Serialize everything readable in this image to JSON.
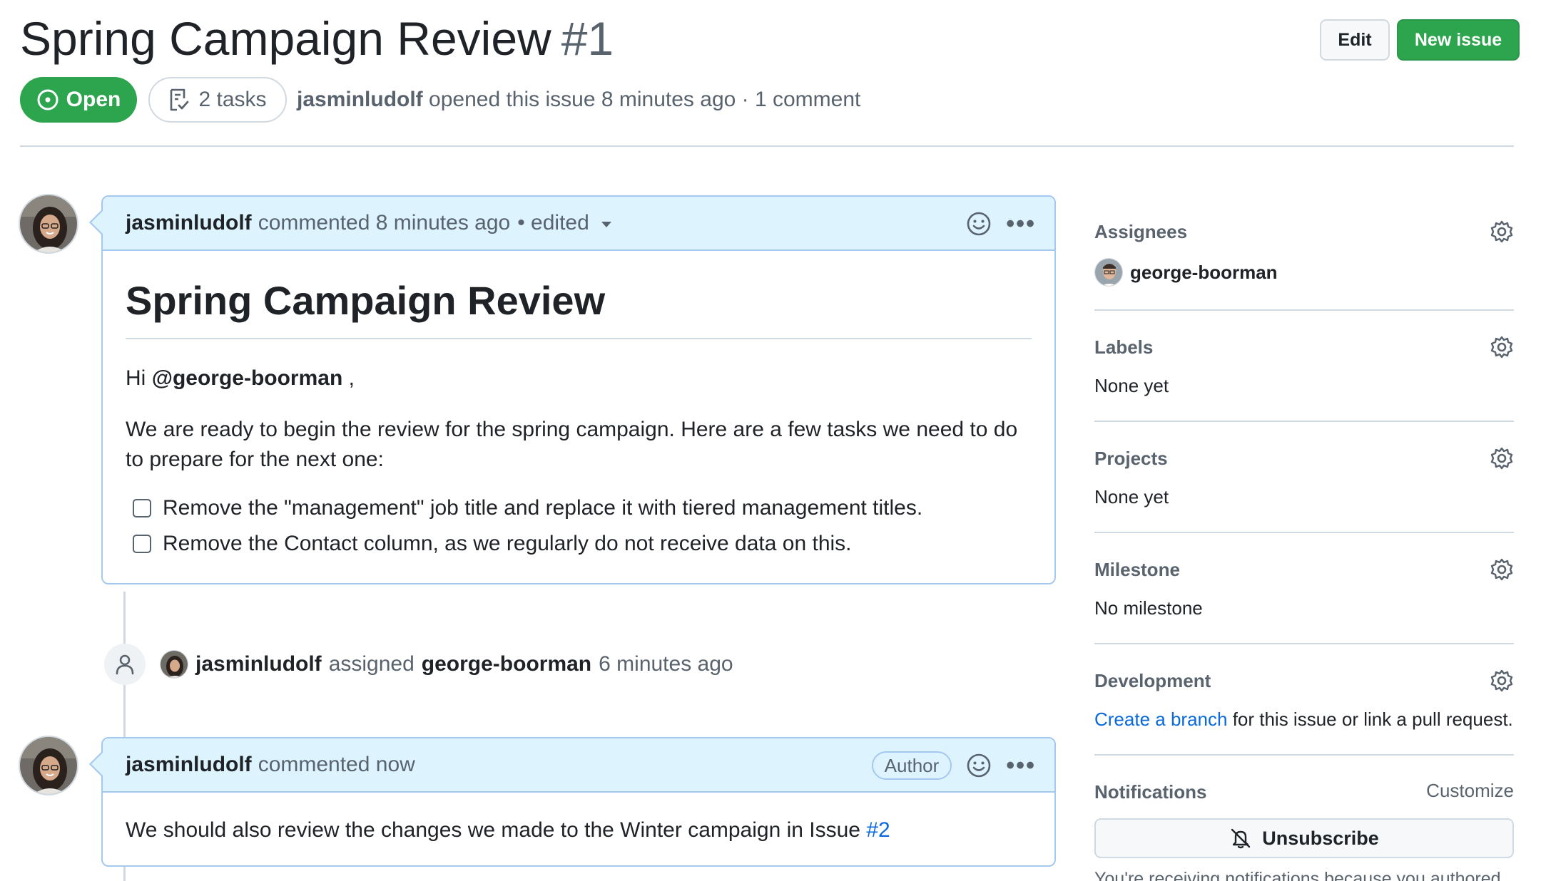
{
  "issue": {
    "title": "Spring Campaign Review",
    "number": "#1",
    "state": "Open",
    "tasks": "2 tasks",
    "author": "jasminludolf",
    "meta_text": "opened this issue 8 minutes ago · 1 comment"
  },
  "header_buttons": {
    "edit": "Edit",
    "new_issue": "New issue"
  },
  "comments": [
    {
      "author": "jasminludolf",
      "action": "commented 8 minutes ago",
      "edited": "• edited",
      "heading": "Spring Campaign Review",
      "greeting_prefix": "Hi",
      "mention": "@george-boorman",
      "greeting_suffix": ",",
      "paragraph": "We are ready to begin the review for the spring campaign. Here are a few tasks we need to do to prepare for the next one:",
      "tasks": [
        "Remove the \"management\" job title and replace it with tiered management titles.",
        "Remove the Contact column, as we regularly do not receive data on this."
      ]
    },
    {
      "author": "jasminludolf",
      "action": "commented now",
      "badge": "Author",
      "body_text": "We should also review the changes we made to the Winter campaign in Issue",
      "body_link": "#2"
    }
  ],
  "event": {
    "actor": "jasminludolf",
    "verb": "assigned",
    "target": "george-boorman",
    "time": "6 minutes ago"
  },
  "sidebar": {
    "assignees": {
      "title": "Assignees",
      "value": "george-boorman"
    },
    "labels": {
      "title": "Labels",
      "value": "None yet"
    },
    "projects": {
      "title": "Projects",
      "value": "None yet"
    },
    "milestone": {
      "title": "Milestone",
      "value": "No milestone"
    },
    "development": {
      "title": "Development",
      "link": "Create a branch",
      "text": "for this issue or link a pull request."
    },
    "notifications": {
      "title": "Notifications",
      "customize": "Customize",
      "button": "Unsubscribe",
      "note": "You're receiving notifications because you authored"
    }
  },
  "colors": {
    "open_green": "#2da44e",
    "comment_header_bg": "#ddf4ff",
    "comment_border": "#a5c8f0",
    "link_blue": "#0969da",
    "muted_text": "#59636e"
  },
  "icons": [
    "issue-open-icon",
    "tasklist-icon",
    "smiley-icon",
    "kebab-icon",
    "person-icon",
    "gear-icon",
    "bell-slash-icon",
    "triangle-down-icon"
  ]
}
